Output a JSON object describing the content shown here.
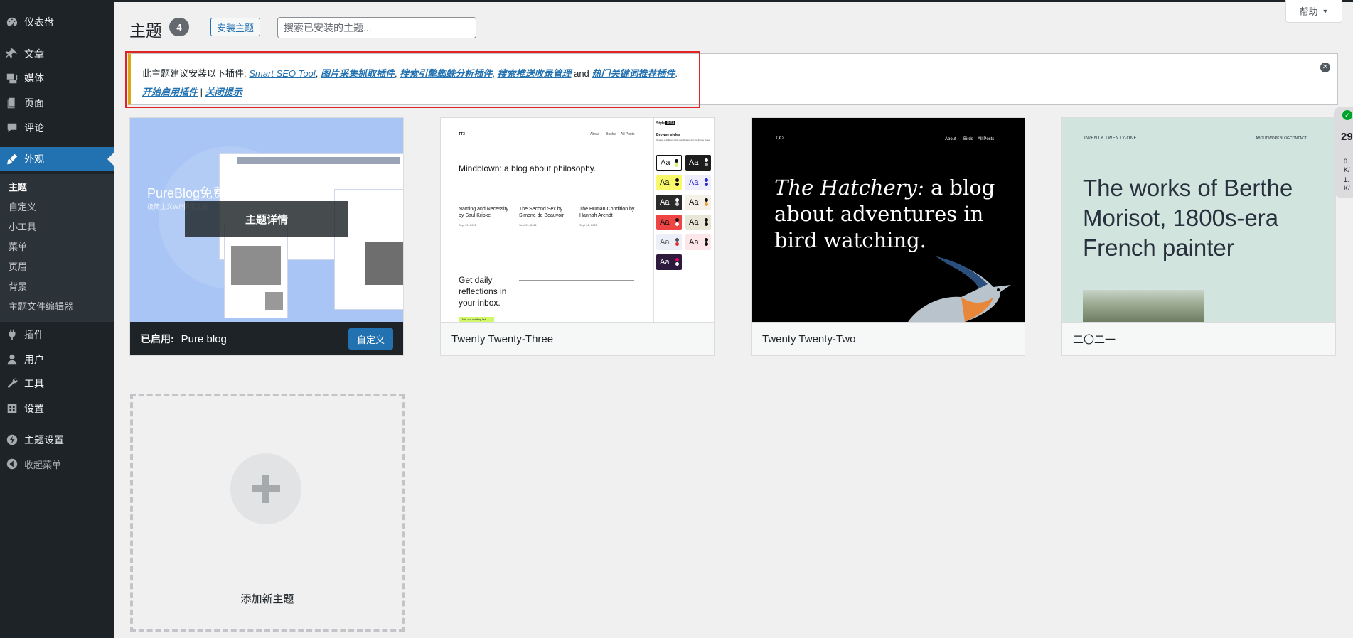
{
  "sidebar": {
    "items": [
      {
        "label": "仪表盘",
        "icon": "dashboard-icon"
      },
      {
        "label": "文章",
        "icon": "pin-icon"
      },
      {
        "label": "媒体",
        "icon": "media-icon"
      },
      {
        "label": "页面",
        "icon": "page-icon"
      },
      {
        "label": "评论",
        "icon": "comment-icon"
      },
      {
        "label": "外观",
        "icon": "brush-icon"
      },
      {
        "label": "插件",
        "icon": "plugin-icon"
      },
      {
        "label": "用户",
        "icon": "user-icon"
      },
      {
        "label": "工具",
        "icon": "wrench-icon"
      },
      {
        "label": "设置",
        "icon": "settings-icon"
      },
      {
        "label": "主题设置",
        "icon": "bolt-icon"
      }
    ],
    "submenu": [
      "主题",
      "自定义",
      "小工具",
      "菜单",
      "页眉",
      "背景",
      "主题文件编辑器"
    ],
    "collapse_label": "收起菜单"
  },
  "header": {
    "title": "主题",
    "count": "4",
    "install_label": "安装主题",
    "search_placeholder": "搜索已安装的主题...",
    "help_label": "帮助"
  },
  "notice": {
    "prefix": "此主题建议安装以下插件: ",
    "plugins": [
      "Smart SEO Tool",
      "图片采集抓取插件",
      "搜索引擎蜘蛛分析插件",
      "搜索推送收录管理",
      "热门关键词推荐插件"
    ],
    "comma": ",",
    "and": " and ",
    "period": ".",
    "activate_link": "开始启用插件",
    "separator": " | ",
    "dismiss_link": "关闭提示"
  },
  "themes": [
    {
      "name": "Pure blog",
      "active": true,
      "active_label": "已启用:",
      "customize_label": "自定义",
      "details_label": "主题详情",
      "shot_title": "PureBlog免费主题",
      "shot_subtitle": "极简主义WP博客主题"
    },
    {
      "name": "Twenty Twenty-Three",
      "shot": {
        "logo": "TT3",
        "nav": [
          "About",
          "Books",
          "All Posts"
        ],
        "panel_title": "Styles",
        "panel_badge": "Beta",
        "panel_heading": "Browse styles",
        "panel_desc": "Choose a different style combination for the theme styles",
        "headline": "Mindblown: a blog about philosophy.",
        "posts": [
          {
            "title": "Naming and Necessity by Saul Kripke",
            "date": "Sept 21, 2021"
          },
          {
            "title": "The Second Sex by Simone de Beauvoir",
            "date": "Sept 21, 2021"
          },
          {
            "title": "The Human Condition by Hannah Arendt",
            "date": "Sept 21, 2021"
          }
        ],
        "cta": "Get daily reflections in your inbox.",
        "cta_button": "Join our mailing list",
        "swatch_label": "Aa"
      }
    },
    {
      "name": "Twenty Twenty-Two",
      "shot": {
        "nav": [
          "About",
          "Birds",
          "All Posts"
        ],
        "headline_em": "The Hatchery:",
        "headline_rest": " a blog about adventures in bird watching."
      }
    },
    {
      "name": "二〇二一",
      "shot": {
        "site_title": "TWENTY TWENTY-ONE",
        "nav": [
          "ABOUT",
          "WORK",
          "BLOG",
          "CONTACT"
        ],
        "headline": "The works of Berthe Morisot, 1800s-era French painter"
      }
    }
  ],
  "add_new_label": "添加新主题",
  "side_widget": {
    "value": "29",
    "line1": "0.",
    "line1b": "K/",
    "line2": "1.",
    "line2b": "K/"
  },
  "colors": {
    "sidebar_bg": "#1d2327",
    "accent": "#2271b1",
    "notice_border": "#dba617",
    "highlight": "#e02424"
  }
}
